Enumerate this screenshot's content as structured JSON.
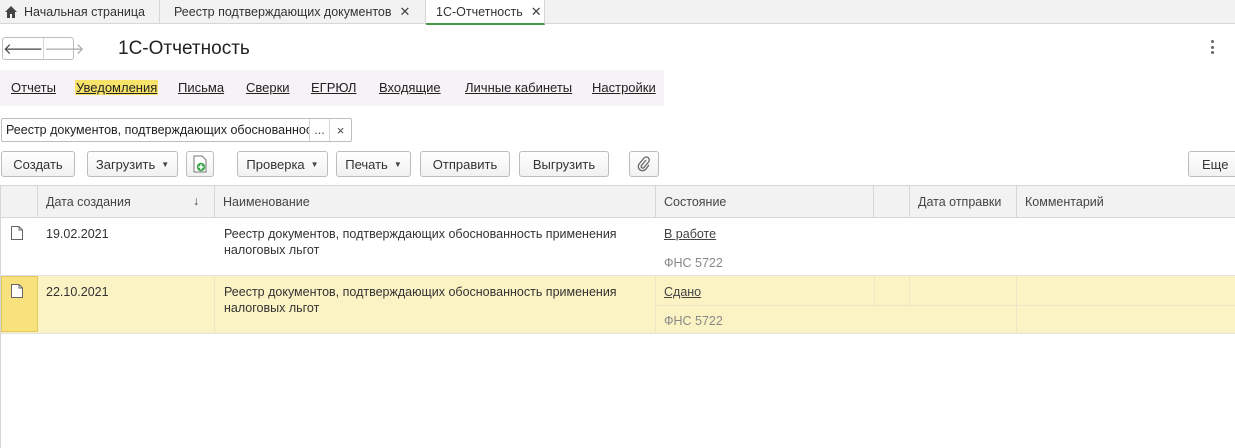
{
  "tabs": [
    {
      "label": "Начальная страница"
    },
    {
      "label": "Реестр подтверждающих документов"
    },
    {
      "label": "1С-Отчетность"
    }
  ],
  "header": {
    "title": "1С-Отчетность"
  },
  "sections": [
    "Отчеты",
    "Уведомления",
    "Письма",
    "Сверки",
    "ЕГРЮЛ",
    "Входящие",
    "Личные кабинеты",
    "Настройки"
  ],
  "selector": {
    "value": "Реестр документов, подтверждающих обоснованность применения налоговых льгот",
    "dots": "...",
    "clear": "×"
  },
  "toolbar": {
    "create": "Создать",
    "load": "Загрузить",
    "check": "Проверка",
    "print": "Печать",
    "send": "Отправить",
    "export": "Выгрузить",
    "more": "Еще"
  },
  "table": {
    "headers": {
      "date_created": "Дата создания",
      "sort_arrow": "↓",
      "name": "Наименование",
      "state": "Состояние",
      "date_sent": "Дата отправки",
      "comment": "Комментарий"
    },
    "rows": [
      {
        "date": "19.02.2021",
        "name": "Реестр документов, подтверждающих обоснованность применения налоговых льгот",
        "state": "В работе",
        "recipient": "ФНС 5722",
        "date_sent": "",
        "comment": ""
      },
      {
        "date": "22.10.2021",
        "name": "Реестр документов, подтверждающих обоснованность применения налоговых льгот",
        "state": "Сдано",
        "recipient": "ФНС 5722",
        "date_sent": "",
        "comment": ""
      }
    ]
  },
  "colors": {
    "accent_tab": "#4a9a4a",
    "active_section": "#f7e36a",
    "selected_row": "#fcf3c5"
  }
}
